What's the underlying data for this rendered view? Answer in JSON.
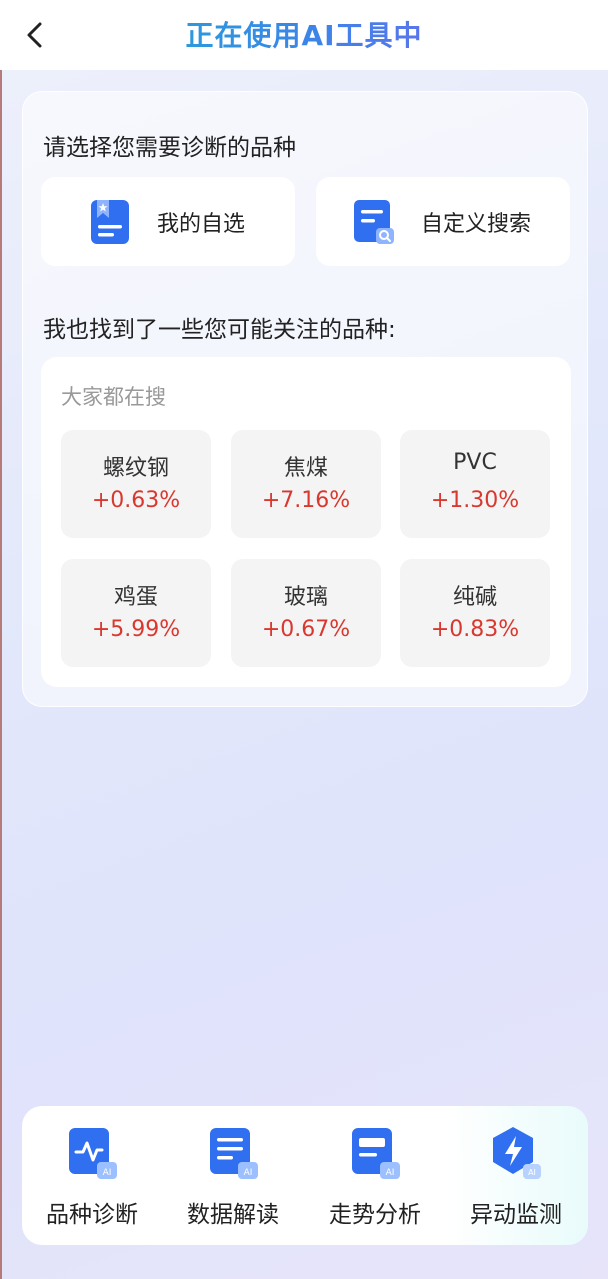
{
  "header": {
    "title": "正在使用AI工具中",
    "back_icon": "chevron-left-icon"
  },
  "select": {
    "title": "请选择您需要诊断的品种",
    "options": [
      {
        "label": "我的自选",
        "icon": "watchlist-icon"
      },
      {
        "label": "自定义搜索",
        "icon": "document-search-icon"
      }
    ]
  },
  "suggest": {
    "title": "我也找到了一些您可能关注的品种:",
    "hot_title": "大家都在搜",
    "items": [
      {
        "name": "螺纹钢",
        "change": "+0.63%"
      },
      {
        "name": "焦煤",
        "change": "+7.16%"
      },
      {
        "name": "PVC",
        "change": "+1.30%"
      },
      {
        "name": "鸡蛋",
        "change": "+5.99%"
      },
      {
        "name": "玻璃",
        "change": "+0.67%"
      },
      {
        "name": "纯碱",
        "change": "+0.83%"
      }
    ]
  },
  "tools": [
    {
      "label": "品种诊断",
      "icon": "pulse-ai-icon"
    },
    {
      "label": "数据解读",
      "icon": "document-ai-icon"
    },
    {
      "label": "走势分析",
      "icon": "analysis-ai-icon"
    },
    {
      "label": "异动监测",
      "icon": "lightning-ai-icon"
    }
  ],
  "colors": {
    "accent_blue": "#2f6ff0",
    "rise_red": "#d9382f",
    "title_gradient_start": "#18b6c9",
    "title_gradient_end": "#8a5cf0"
  }
}
